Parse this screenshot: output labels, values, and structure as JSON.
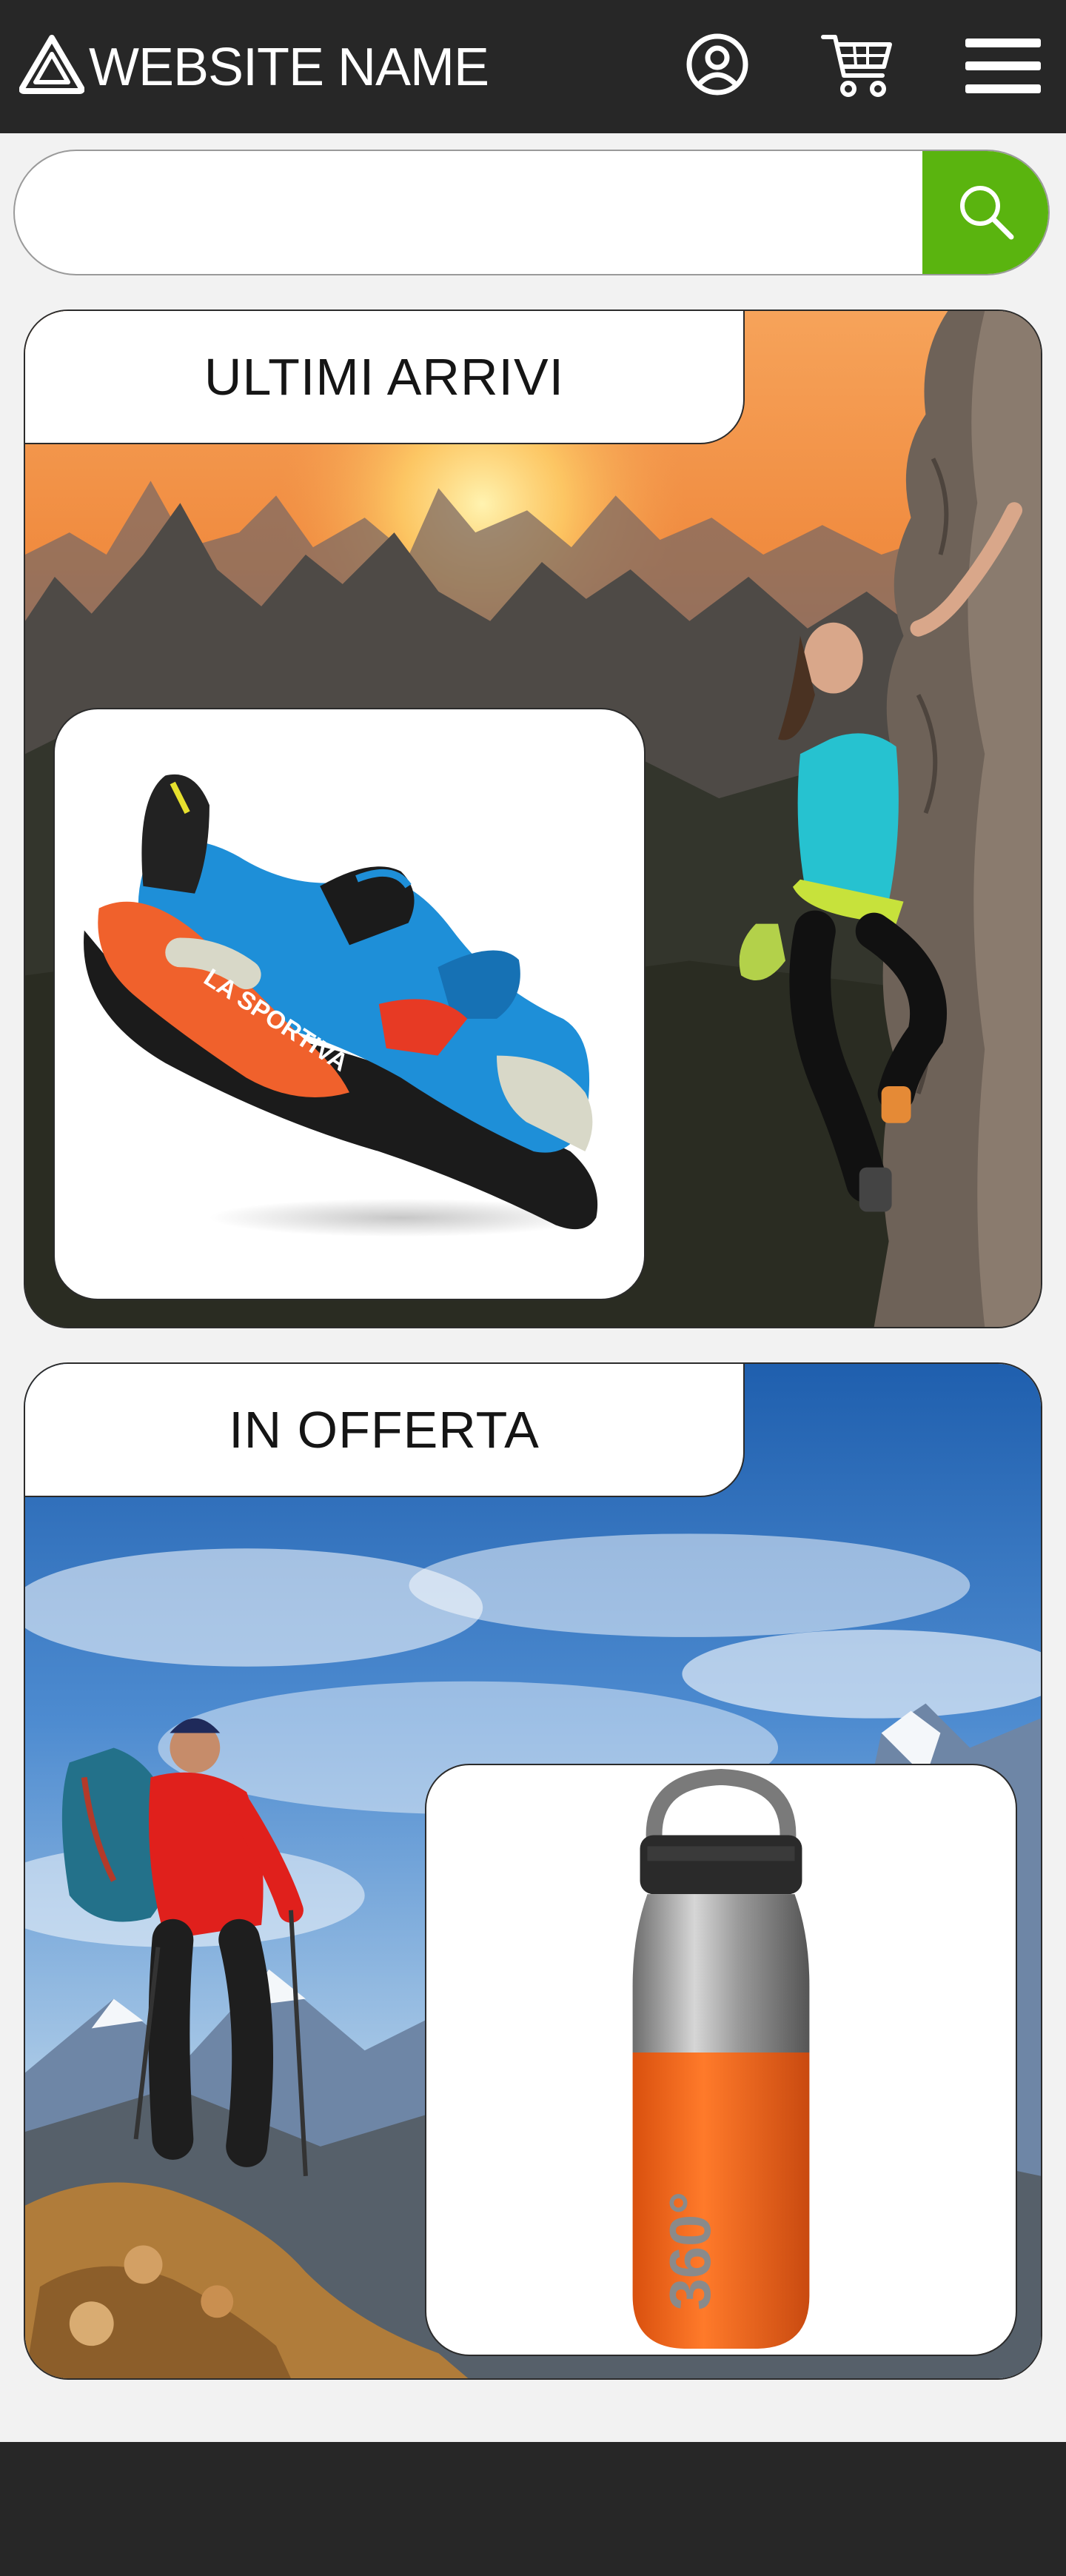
{
  "header": {
    "site_name": "WEBSITE NAME",
    "logo_icon": "triangle-logo-icon",
    "account_icon": "user-circle-icon",
    "cart_icon": "shopping-cart-icon",
    "menu_icon": "hamburger-menu-icon",
    "background": "#272727"
  },
  "search": {
    "value": "",
    "placeholder": "",
    "button_icon": "search-icon",
    "button_color": "#5ab40f"
  },
  "sections": [
    {
      "title": "ULTIMI ARRIVI",
      "scene": "climber on rock face at sunset",
      "product_brand": "LA SPORTIVA",
      "product_icon": "climbing-shoe-image"
    },
    {
      "title": "IN OFFERTA",
      "scene": "hiker with backpack in mountains",
      "product_brand": "360°",
      "product_icon": "water-bottle-image"
    }
  ],
  "footer": {
    "background": "#272727"
  }
}
